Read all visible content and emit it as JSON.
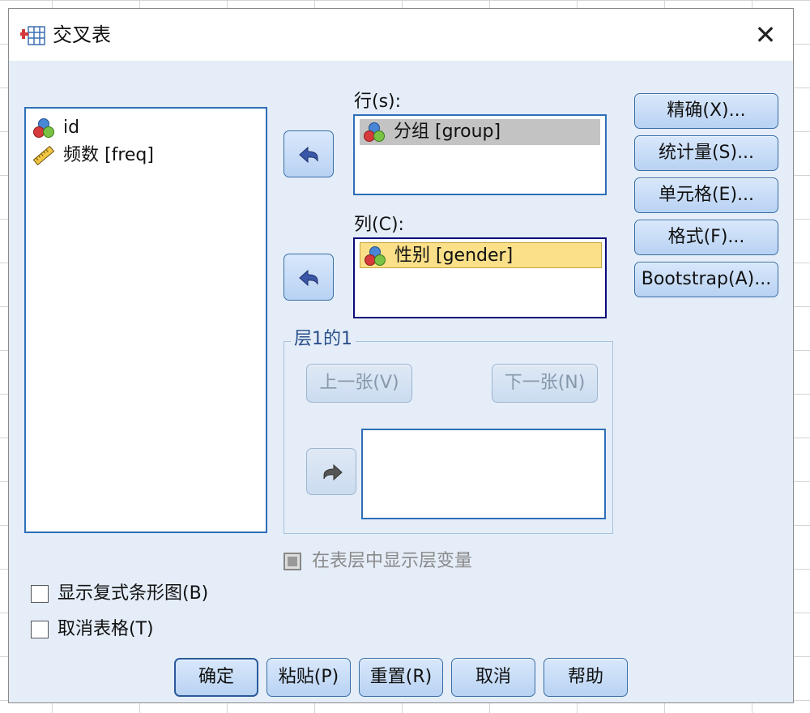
{
  "window": {
    "title": "交叉表",
    "close_glyph": "✕"
  },
  "source_list": {
    "items": [
      {
        "label": "id",
        "icon": "nominal-variable-icon"
      },
      {
        "label": "频数 [freq]",
        "icon": "scale-variable-icon"
      }
    ]
  },
  "rows_box": {
    "label": "行(s):",
    "items": [
      {
        "label": "分组 [group]",
        "icon": "nominal-variable-icon"
      }
    ]
  },
  "columns_box": {
    "label": "列(C):",
    "items": [
      {
        "label": "性别 [gender]",
        "icon": "nominal-variable-icon"
      }
    ]
  },
  "side_buttons": [
    "精确(X)...",
    "统计量(S)...",
    "单元格(E)...",
    "格式(F)...",
    "Bootstrap(A)..."
  ],
  "layer": {
    "title": "层1的1",
    "prev_label": "上一张(V)",
    "next_label": "下一张(N)"
  },
  "checkboxes": {
    "layer_vars": {
      "label": "在表层中显示层变量",
      "enabled": false
    },
    "clustered_bar": {
      "label": "显示复式条形图(B)",
      "checked": false
    },
    "suppress_tables": {
      "label": "取消表格(T)",
      "checked": false
    }
  },
  "bottom_buttons": {
    "ok": "确定",
    "paste": "粘贴(P)",
    "reset": "重置(R)",
    "cancel": "取消",
    "help": "帮助"
  },
  "colors": {
    "accent": "#2e6fb8",
    "dialog_bg": "#e4edf8",
    "selected_yellow": "#fbe089",
    "selected_gray": "#c3c3c3"
  }
}
